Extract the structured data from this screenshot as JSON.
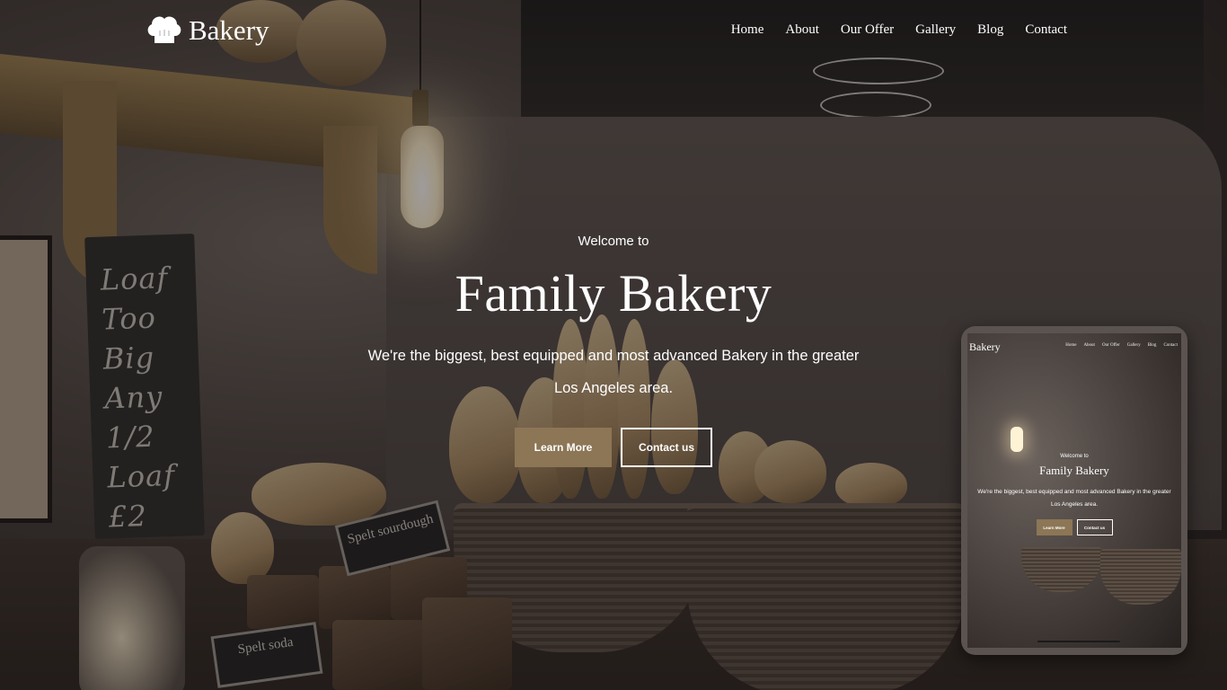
{
  "brand": {
    "name": "Bakery",
    "logo_icon": "chef-hat-icon"
  },
  "nav": {
    "items": [
      {
        "label": "Home"
      },
      {
        "label": "About"
      },
      {
        "label": "Our Offer"
      },
      {
        "label": "Gallery"
      },
      {
        "label": "Blog"
      },
      {
        "label": "Contact"
      }
    ]
  },
  "hero": {
    "welcome": "Welcome to",
    "title": "Family Bakery",
    "tagline": "We're the biggest, best equipped and most advanced Bakery in the greater Los Angeles area.",
    "primary_button": "Learn More",
    "secondary_button": "Contact us"
  },
  "scene": {
    "chalkboard_text": "Loaf Too Big Any 1/2 Loaf £2",
    "card_spelt_sourdough": "Spelt sourdough",
    "card_spelt_soda": "Spelt soda"
  },
  "tablet_preview": {
    "logo": "Bakery",
    "nav": [
      "Home",
      "About",
      "Our Offer",
      "Gallery",
      "Blog",
      "Contact"
    ],
    "welcome": "Welcome to",
    "title": "Family Bakery",
    "tagline": "We're the biggest, best equipped and most advanced Bakery in the greater Los Angeles area.",
    "primary_button": "Learn More",
    "secondary_button": "Contact us"
  },
  "colors": {
    "accent": "#8c7656",
    "text": "#ffffff"
  }
}
